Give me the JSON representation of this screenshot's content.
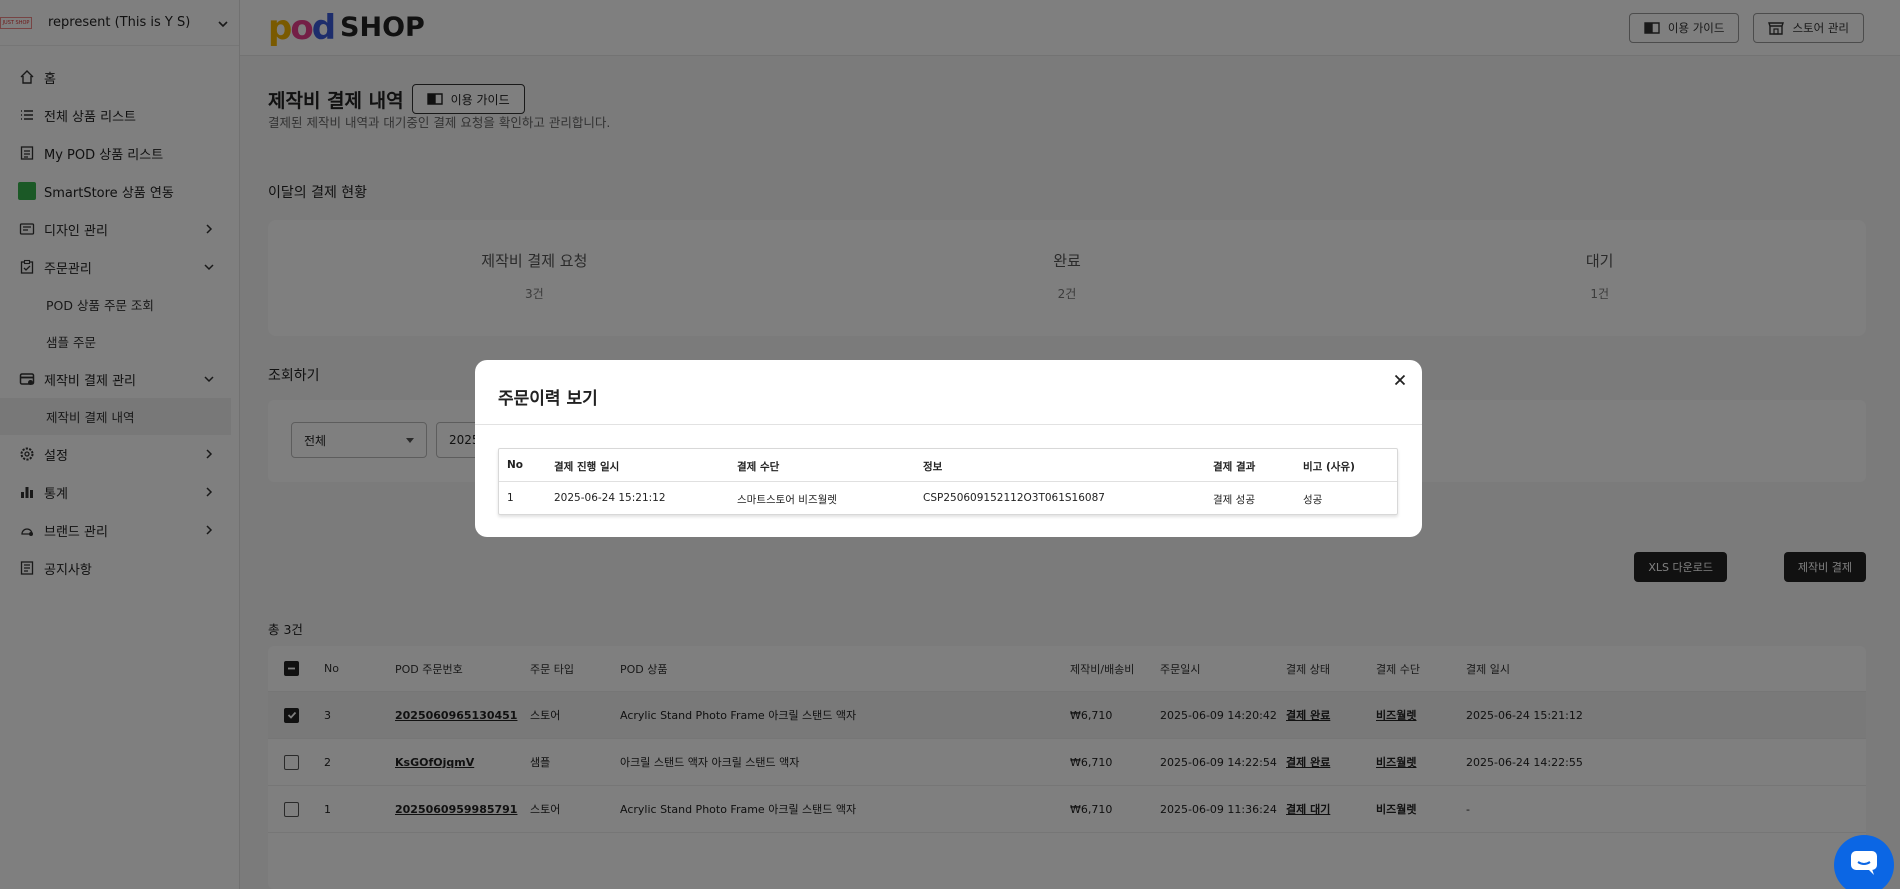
{
  "store": {
    "name": "represent (This is Y S)",
    "logo_text": "JUST SHOP"
  },
  "sidebar": {
    "items": [
      {
        "label": "홈"
      },
      {
        "label": "전체 상품 리스트"
      },
      {
        "label": "My POD 상품 리스트"
      },
      {
        "label": "SmartStore 상품 연동"
      },
      {
        "label": "디자인 관리"
      },
      {
        "label": "주문관리"
      },
      {
        "label": "POD 상품 주문 조회"
      },
      {
        "label": "샘플 주문"
      },
      {
        "label": "제작비 결제 관리"
      },
      {
        "label": "제작비 결제 내역"
      },
      {
        "label": "설정"
      },
      {
        "label": "통계"
      },
      {
        "label": "브랜드 관리"
      },
      {
        "label": "공지사항"
      }
    ]
  },
  "header": {
    "logo_pod": "pod",
    "logo_shop": "SHOP",
    "guide_label": "이용 가이드",
    "store_label": "스토어 관리"
  },
  "page": {
    "title": "제작비 결제 내역",
    "guide_label": "이용 가이드",
    "description": "결제된 제작비 내역과 대기중인 결제 요청을 확인하고 관리합니다.",
    "monthly_label": "이달의 결제 현황",
    "stats": [
      {
        "title": "제작비 결제 요청",
        "value": "3건"
      },
      {
        "title": "완료",
        "value": "2건"
      },
      {
        "title": "대기",
        "value": "1건"
      }
    ],
    "search_label": "조회하기",
    "filter_select": "전체",
    "date_value": "2025",
    "xls_label": "XLS 다운로드",
    "pay_label": "제작비 결제",
    "total": "총 3건"
  },
  "table": {
    "columns": [
      "No",
      "POD 주문번호",
      "주문 타입",
      "POD 상품",
      "제작비/배송비",
      "주문일시",
      "결제 상태",
      "결제 수단",
      "결제 일시"
    ],
    "rows": [
      {
        "no": "3",
        "order": "2025060965130451",
        "type": "스토어",
        "product": "Acrylic Stand Photo Frame 아크릴 스탠드 액자",
        "cost": "₩6,710",
        "date": "2025-06-09 14:20:42",
        "status": "결제 완료",
        "method": "비즈월렛",
        "paid": "2025-06-24 15:21:12",
        "checked": true
      },
      {
        "no": "2",
        "order": "KsGOfOjqmV",
        "type": "샘플",
        "product": "아크릴 스탠드 액자 아크릴 스탠드 액자",
        "cost": "₩6,710",
        "date": "2025-06-09 14:22:54",
        "status": "결제 완료",
        "method": "비즈월렛",
        "paid": "2025-06-24 14:22:55",
        "checked": false
      },
      {
        "no": "1",
        "order": "2025060959985791",
        "type": "스토어",
        "product": "Acrylic Stand Photo Frame 아크릴 스탠드 액자",
        "cost": "₩6,710",
        "date": "2025-06-09 11:36:24",
        "status": "결제 대기",
        "method": "비즈월렛",
        "paid": "-",
        "checked": false
      }
    ]
  },
  "modal": {
    "title": "주문이력 보기",
    "columns": [
      "No",
      "결제 진행 일시",
      "결제 수단",
      "정보",
      "결제 결과",
      "비고 (사유)"
    ],
    "rows": [
      {
        "no": "1",
        "datetime": "2025-06-24 15:21:12",
        "method": "스마트스토어 비즈월렛",
        "info": "CSP250609152112O3T061S16087",
        "result": "결제 성공",
        "note": "성공"
      }
    ]
  },
  "colors": {
    "accent_dark": "#222222",
    "chat": "#0b66e4",
    "logo_yellow": "#f5b400",
    "logo_pink": "#e83e8c",
    "logo_blue": "#3a5bd9"
  }
}
